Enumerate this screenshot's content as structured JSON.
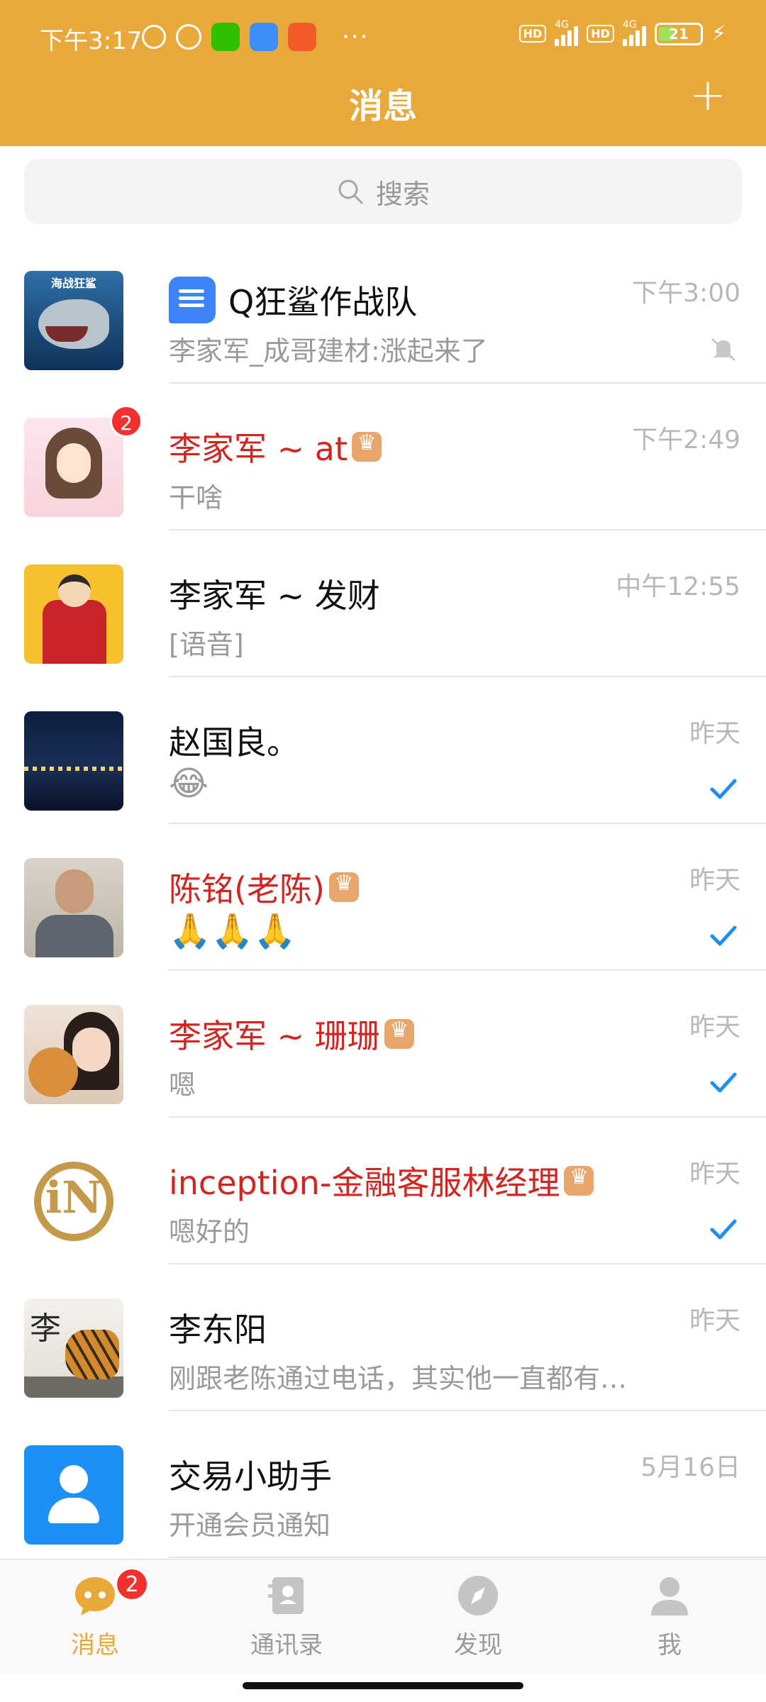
{
  "status_bar": {
    "time": "下午3:17",
    "network_1": "4G",
    "network_2": "4G",
    "hd": "HD",
    "battery": "21",
    "overflow": "···"
  },
  "header": {
    "title": "消息",
    "add_label": "+"
  },
  "search": {
    "placeholder": "搜索"
  },
  "conversations": [
    {
      "name": "Q狂鲨作战队",
      "preview": "李家军_成哥建材:涨起来了",
      "time": "下午3:00",
      "avatar_caption": "海战狂鲨",
      "status": "muted-icon",
      "type": "group"
    },
    {
      "name": "李家军 ~ at",
      "preview": "干啥",
      "time": "下午2:49",
      "badge": "2",
      "vip": true
    },
    {
      "name": "李家军 ~ 发财",
      "preview": "[语音]",
      "time": "中午12:55"
    },
    {
      "name": "赵国良。",
      "preview": "😂",
      "time": "昨天",
      "status": "check-icon"
    },
    {
      "name": "陈铭(老陈)",
      "preview": "🙏🙏🙏",
      "time": "昨天",
      "status": "check-icon",
      "vip": true
    },
    {
      "name": "李家军 ~ 珊珊",
      "preview": "嗯",
      "time": "昨天",
      "status": "check-icon",
      "vip": true
    },
    {
      "name": "inception-金融客服林经理",
      "preview": "嗯好的",
      "time": "昨天",
      "status": "check-icon",
      "vip": true,
      "avatar_letter": "iN"
    },
    {
      "name": "李东阳",
      "preview": "刚跟老陈通过电话，其实他一直都有…",
      "time": "昨天",
      "avatar_char": "李"
    },
    {
      "name": "交易小助手",
      "preview": "开通会员通知",
      "time": "5月16日"
    }
  ],
  "bottom_nav": [
    {
      "label": "消息",
      "icon": "chat-bubble-icon",
      "badge": "2",
      "active": true
    },
    {
      "label": "通讯录",
      "icon": "contacts-book-icon"
    },
    {
      "label": "发现",
      "icon": "compass-icon"
    },
    {
      "label": "我",
      "icon": "person-icon"
    }
  ],
  "colors": {
    "brand": "#E9A83A",
    "vip_name": "#D4241F",
    "badge": "#F0312D",
    "check": "#1E8FF7"
  }
}
